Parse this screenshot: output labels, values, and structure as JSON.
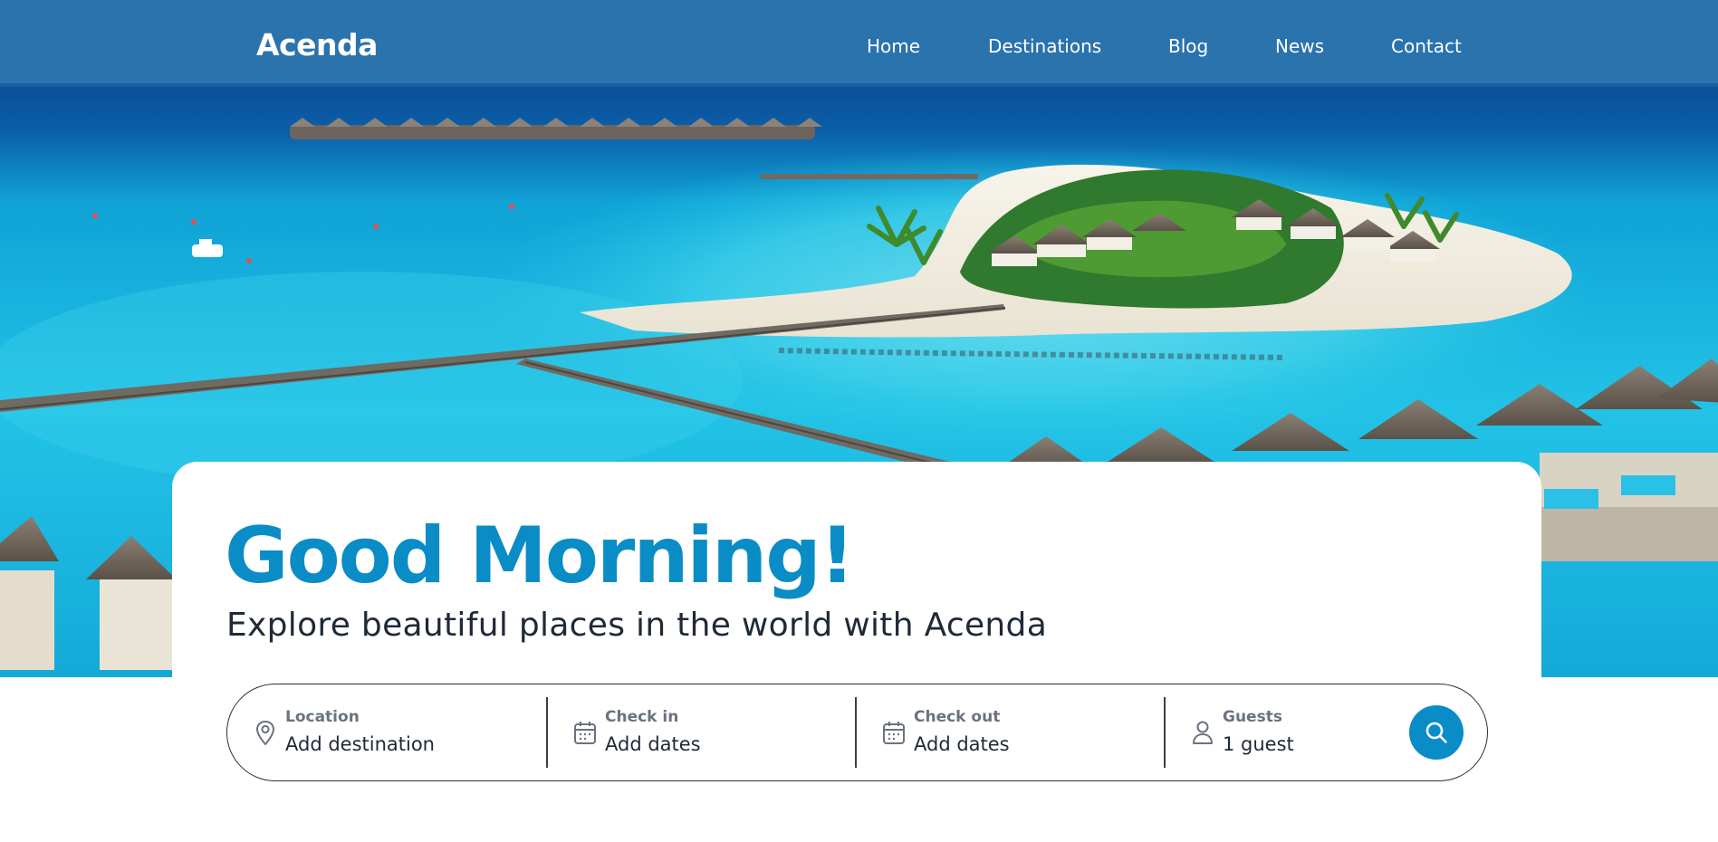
{
  "brand": {
    "name": "Acenda"
  },
  "nav": {
    "items": [
      {
        "label": "Home"
      },
      {
        "label": "Destinations"
      },
      {
        "label": "Blog"
      },
      {
        "label": "News"
      },
      {
        "label": "Contact"
      }
    ]
  },
  "hero": {
    "greeting": "Good Morning!",
    "subtitle": "Explore beautiful places in the world with Acenda"
  },
  "search": {
    "fields": [
      {
        "label": "Location",
        "value": "Add destination",
        "icon": "map-pin-icon"
      },
      {
        "label": "Check in",
        "value": "Add dates",
        "icon": "calendar-icon"
      },
      {
        "label": "Check out",
        "value": "Add dates",
        "icon": "calendar-icon"
      },
      {
        "label": "Guests",
        "value": "1 guest",
        "icon": "user-icon"
      }
    ],
    "button_icon": "search-icon"
  },
  "colors": {
    "accent": "#0a8cc6",
    "text_dark": "#1f2937",
    "label_gray": "#6b7280"
  }
}
